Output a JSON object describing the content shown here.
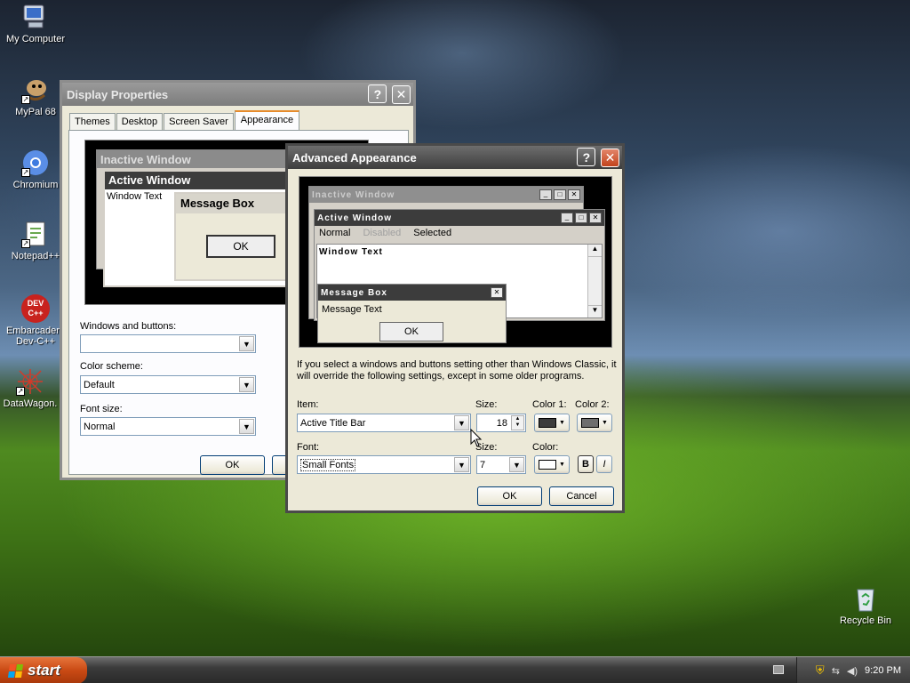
{
  "desktop": {
    "icons": [
      {
        "label": "My Computer"
      },
      {
        "label": "MyPal 68"
      },
      {
        "label": "Chromium"
      },
      {
        "label": "Notepad++"
      },
      {
        "label": "Embarcadero Dev-C++",
        "line1": "Embarcadero",
        "line2": "Dev-C++",
        "badge_top": "DEV",
        "badge_bottom": "C++"
      },
      {
        "label": "DataWagon."
      },
      {
        "label": "Recycle Bin"
      }
    ]
  },
  "display_properties": {
    "title": "Display Properties",
    "help": "?",
    "close": "✕",
    "tabs": [
      "Themes",
      "Desktop",
      "Screen Saver",
      "Appearance"
    ],
    "active_tab": "Appearance",
    "preview": {
      "inactive_title": "Inactive Window",
      "active_title": "Active Window",
      "window_text": "Window Text",
      "message_box_title": "Message Box",
      "ok": "OK"
    },
    "windows_and_buttons_label": "Windows and buttons:",
    "windows_and_buttons_value": "",
    "color_scheme_label": "Color scheme:",
    "color_scheme_value": "Default",
    "font_size_label": "Font size:",
    "font_size_value": "Normal",
    "ok_button": "OK"
  },
  "advanced_appearance": {
    "title": "Advanced Appearance",
    "help": "?",
    "close": "✕",
    "preview": {
      "inactive_title": "Inactive Window",
      "active_title": "Active Window",
      "menu_normal": "Normal",
      "menu_disabled": "Disabled",
      "menu_selected": "Selected",
      "window_text": "Window Text",
      "message_box_title": "Message Box",
      "message_text": "Message Text",
      "ok": "OK"
    },
    "info_text": "If you select a windows and buttons setting other than Windows Classic, it will override the following settings, except in some older programs.",
    "item_label": "Item:",
    "item_value": "Active Title Bar",
    "item_size_label": "Size:",
    "item_size_value": "18",
    "color1_label": "Color 1:",
    "color2_label": "Color 2:",
    "font_label": "Font:",
    "font_value": "Small Fonts",
    "font_size_label": "Size:",
    "font_size_value": "7",
    "font_color_label": "Color:",
    "bold": "B",
    "italic": "I",
    "ok_button": "OK",
    "cancel_button": "Cancel",
    "colors": {
      "color1": "#3c3c3c",
      "color2": "#6e6e6e",
      "font_color": "#ffffff"
    }
  },
  "taskbar": {
    "start_label": "start",
    "clock": "9:20 PM"
  }
}
